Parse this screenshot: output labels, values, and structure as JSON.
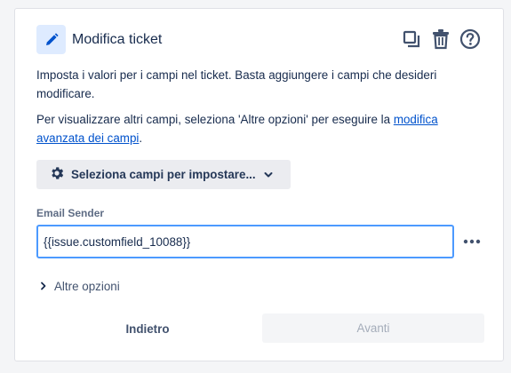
{
  "header": {
    "title": "Modifica ticket",
    "icons": [
      "pencil-icon",
      "duplicate-icon",
      "trash-icon",
      "help-icon"
    ]
  },
  "description": {
    "line1": "Imposta i valori per i campi nel ticket. Basta aggiungere i campi che desideri modificare.",
    "line2_prefix": "Per visualizzare altri campi, seleziona 'Altre opzioni' per eseguire la ",
    "line2_link": "modifica avanzata dei campi",
    "line2_suffix": "."
  },
  "select_fields": {
    "label": "Seleziona campi per impostare..."
  },
  "field": {
    "label": "Email Sender",
    "value": "{{issue.customfield_10088}}"
  },
  "more_options": {
    "label": "Altre opzioni"
  },
  "footer": {
    "back_label": "Indietro",
    "next_label": "Avanti"
  },
  "colors": {
    "accent": "#0052cc",
    "focus_border": "#4c9aff",
    "icon_bg": "#deebff"
  }
}
